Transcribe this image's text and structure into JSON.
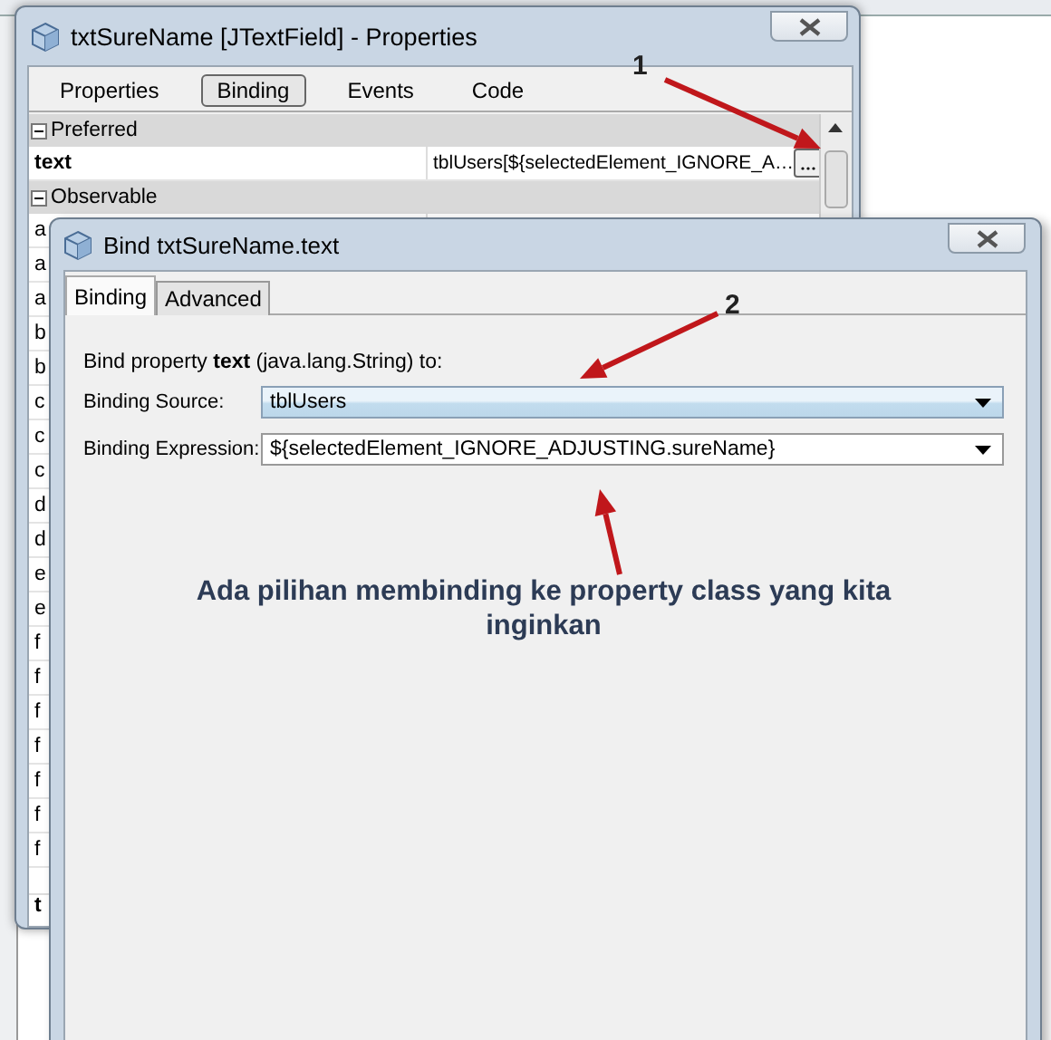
{
  "properties_window": {
    "title": "txtSureName [JTextField] - Properties",
    "tabs": [
      {
        "label": "Properties",
        "selected": false
      },
      {
        "label": "Binding",
        "selected": true
      },
      {
        "label": "Events",
        "selected": false
      },
      {
        "label": "Code",
        "selected": false
      }
    ],
    "sections": [
      {
        "name": "Preferred",
        "expanded": true,
        "rows": [
          {
            "name": "text",
            "value": "tblUsers[${selectedElement_IGNORE_A…"
          }
        ]
      },
      {
        "name": "Observable",
        "expanded": true,
        "rows": [
          {
            "name": "a"
          },
          {
            "name": "a"
          },
          {
            "name": "a"
          },
          {
            "name": "b"
          },
          {
            "name": "b"
          },
          {
            "name": "c"
          },
          {
            "name": "c"
          },
          {
            "name": "c"
          },
          {
            "name": "d"
          },
          {
            "name": "d"
          },
          {
            "name": "e"
          },
          {
            "name": "e"
          },
          {
            "name": "f"
          },
          {
            "name": "f"
          },
          {
            "name": "f"
          },
          {
            "name": "f"
          },
          {
            "name": "f"
          },
          {
            "name": "f"
          },
          {
            "name": "f"
          }
        ]
      }
    ],
    "bottom_label": "t"
  },
  "bind_dialog": {
    "title": "Bind txtSureName.text",
    "tabs": [
      {
        "label": "Binding",
        "selected": true
      },
      {
        "label": "Advanced",
        "selected": false
      }
    ],
    "prompt": "Bind property **text** (java.lang.String) to:",
    "fields": [
      {
        "label": "Binding Source:",
        "value": "tblUsers",
        "highlighted": true
      },
      {
        "label": "Binding Expression:",
        "value": "${selectedElement_IGNORE_ADJUSTING.sureName}",
        "highlighted": false
      }
    ]
  },
  "annotations": {
    "markers": [
      "1",
      "2"
    ],
    "note": "Ada pilihan membinding ke property class yang kita inginkan"
  }
}
